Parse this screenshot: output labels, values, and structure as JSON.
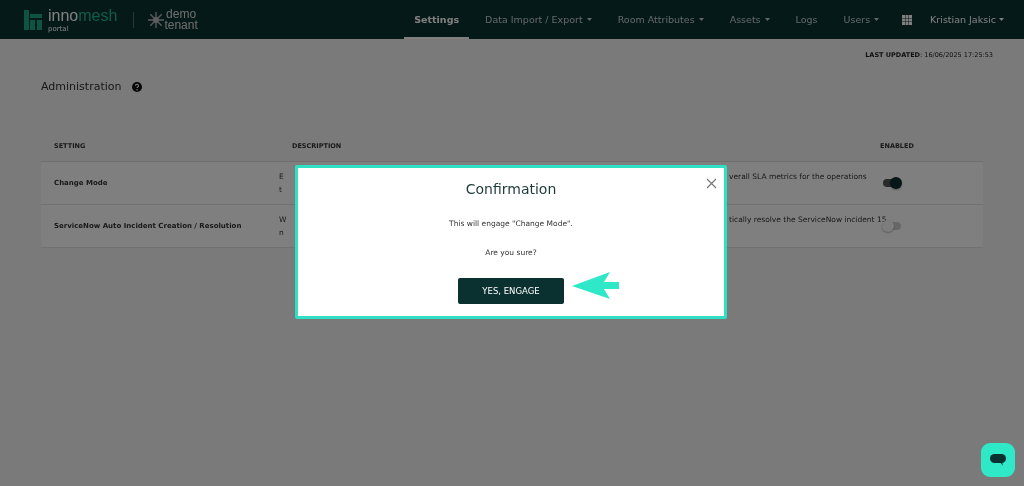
{
  "header": {
    "logo": {
      "word_start": "inno",
      "word_end": "mesh",
      "sub": "portal"
    },
    "tenant": {
      "line_1": "demo",
      "line_2": "tenant"
    },
    "nav": [
      {
        "label": "Settings",
        "selected": true,
        "has_menu": false
      },
      {
        "label": "Data Import / Export",
        "selected": false,
        "has_menu": true
      },
      {
        "label": "Room Attributes",
        "selected": false,
        "has_menu": true
      },
      {
        "label": "Assets",
        "selected": false,
        "has_menu": true
      },
      {
        "label": "Logs",
        "selected": false,
        "has_menu": false
      },
      {
        "label": "Users",
        "selected": false,
        "has_menu": true
      }
    ],
    "user": "Kristian Jaksic"
  },
  "last_updated": {
    "label": "LAST UPDATED",
    "value": ": 16/06/2025 17:25:53"
  },
  "page_title": "Administration",
  "table": {
    "columns": [
      "SETTING",
      "DESCRIPTION",
      "ENABLED"
    ],
    "rows": [
      {
        "setting": "Change Mode",
        "description_lines": [
          {
            "left": "E",
            "right": "verall SLA metrics for the operations"
          },
          {
            "left": "t"
          }
        ],
        "on": true
      },
      {
        "setting": "ServiceNow Auto Incident Creation / Resolution",
        "description_lines": [
          {
            "left": "W",
            "right": "tically resolve the ServiceNow incident 15"
          },
          {
            "left": "n"
          }
        ],
        "on": false
      }
    ]
  },
  "dialog": {
    "title": "Confirmation",
    "message": "This will engage \"Change Mode\".",
    "question": "Are you sure?",
    "button": "YES, ENGAGE"
  }
}
